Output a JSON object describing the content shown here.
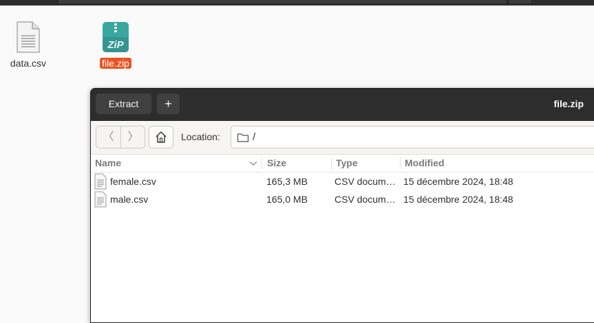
{
  "desktop": {
    "icons": [
      {
        "label": "data.csv",
        "icon": "text-file-icon"
      },
      {
        "label": "file.zip",
        "icon": "zip-archive-icon",
        "badge": "ZiP",
        "selected": true
      }
    ]
  },
  "window": {
    "title": "file.zip",
    "extract_label": "Extract",
    "add_label": "+"
  },
  "toolbar": {
    "back_glyph": "〈",
    "forward_glyph": "〉",
    "location_label": "Location:",
    "location_path": "/"
  },
  "columns": {
    "name": "Name",
    "size": "Size",
    "type": "Type",
    "modified": "Modified"
  },
  "files": [
    {
      "name": "female.csv",
      "size": "165,3 MB",
      "type": "CSV docum…",
      "modified": "15 décembre 2024, 18:48"
    },
    {
      "name": "male.csv",
      "size": "165,0 MB",
      "type": "CSV docum…",
      "modified": "15 décembre 2024, 18:48"
    }
  ],
  "colors": {
    "selection": "#e95420",
    "zip_icon": "#3aa6a0",
    "headerbar": "#2d2d2d"
  }
}
